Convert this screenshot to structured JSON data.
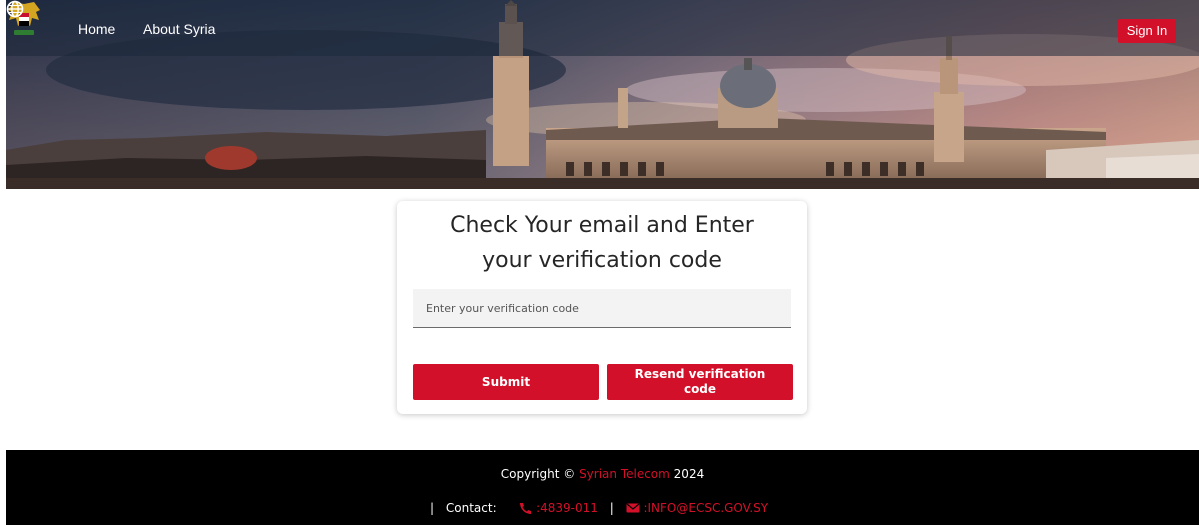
{
  "nav": {
    "home_label": "Home",
    "about_label": "About Syria",
    "signin_label": "Sign In",
    "icons": {
      "emblem": "syria-emblem-icon",
      "language": "globe-icon"
    }
  },
  "card": {
    "title_line1": "Check Your email and Enter",
    "title_line2": "your verification code",
    "input_placeholder": "Enter your verification code",
    "input_value": "",
    "submit_label": "Submit",
    "resend_label": "Resend verification code"
  },
  "footer": {
    "copyright_prefix": "Copyright ©",
    "company": "Syrian Telecom",
    "year": "2024",
    "contact_label": "Contact:",
    "phone": ":4839-011",
    "email": ":INFO@ECSC.GOV.SY",
    "icons": {
      "phone": "phone-icon",
      "email": "mail-icon"
    }
  },
  "colors": {
    "accent": "#d3102a",
    "footer_bg": "#000000",
    "card_bg": "#ffffff"
  }
}
